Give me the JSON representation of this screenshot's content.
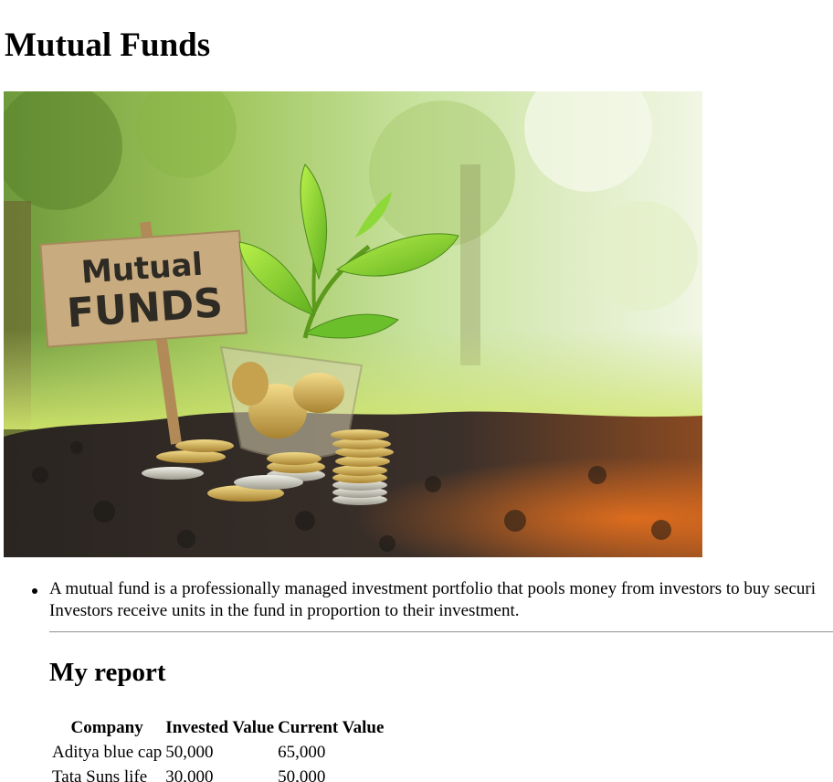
{
  "page": {
    "title": "Mutual Funds"
  },
  "hero_image": {
    "sign_line1": "Mutual",
    "sign_line2": "FUNDS"
  },
  "content": {
    "description_line1": "A mutual fund is a professionally managed investment portfolio that pools money from investors to buy securi",
    "description_line2": "Investors receive units in the fund in proportion to their investment."
  },
  "report": {
    "heading": "My report",
    "columns": [
      "Company",
      "Invested Value",
      "Current Value"
    ],
    "rows": [
      [
        "Aditya blue cap",
        "50,000",
        "65,000"
      ],
      [
        "Tata Suns life",
        "30,000",
        "50,000"
      ]
    ]
  }
}
